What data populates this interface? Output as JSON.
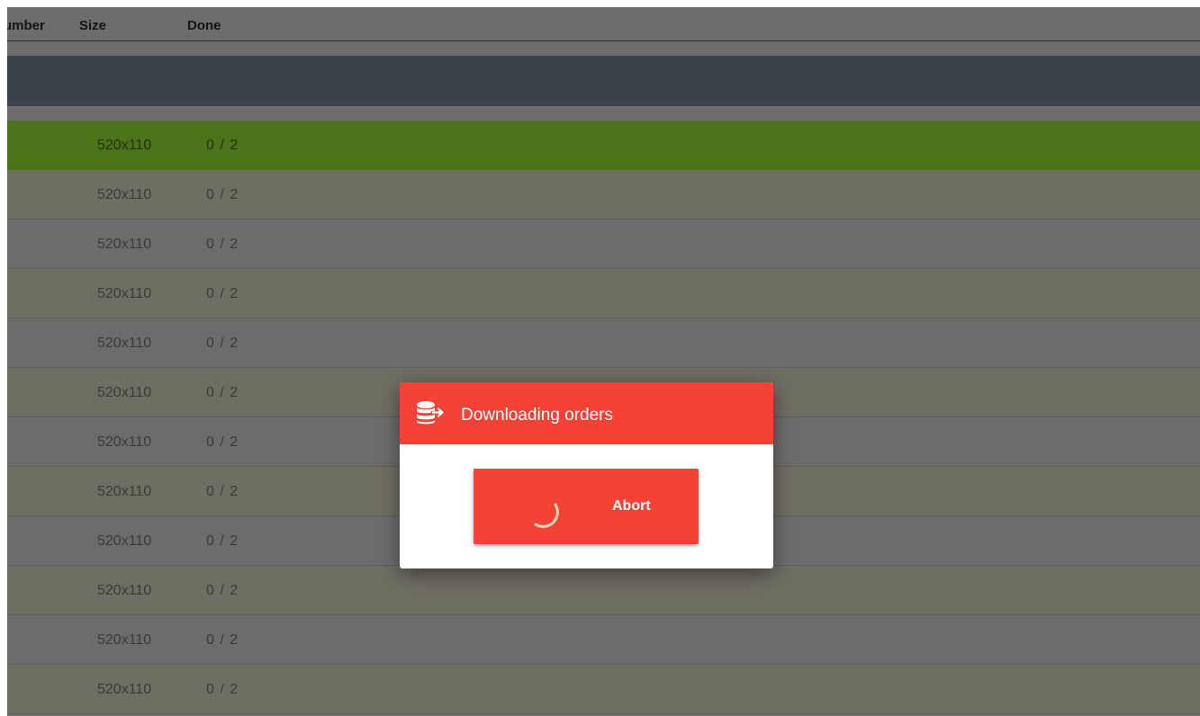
{
  "table": {
    "columns": {
      "number": "umber",
      "size": "Size",
      "done": "Done"
    },
    "rows": [
      {
        "size": "520x110",
        "done": "0 / 2",
        "selected": true
      },
      {
        "size": "520x110",
        "done": "0 / 2"
      },
      {
        "size": "520x110",
        "done": "0 / 2"
      },
      {
        "size": "520x110",
        "done": "0 / 2"
      },
      {
        "size": "520x110",
        "done": "0 / 2"
      },
      {
        "size": "520x110",
        "done": "0 / 2"
      },
      {
        "size": "520x110",
        "done": "0 / 2"
      },
      {
        "size": "520x110",
        "done": "0 / 2"
      },
      {
        "size": "520x110",
        "done": "0 / 2"
      },
      {
        "size": "520x110",
        "done": "0 / 2"
      },
      {
        "size": "520x110",
        "done": "0 / 2"
      },
      {
        "size": "520x110",
        "done": "0 / 2"
      }
    ]
  },
  "dialog": {
    "title": "Downloading orders",
    "icon": "database-export-icon",
    "abort_label": "Abort"
  },
  "colors": {
    "accent": "#f44336",
    "selected_row": "#4b7317",
    "group_bar": "#3c4249"
  }
}
